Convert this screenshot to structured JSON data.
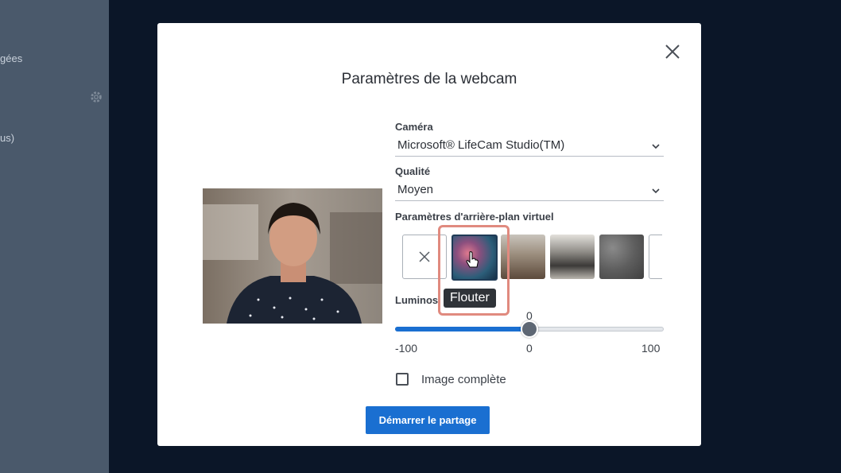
{
  "background": {
    "sidebar_fragments": [
      "gées",
      "us)"
    ]
  },
  "modal": {
    "title": "Paramètres de la webcam",
    "camera": {
      "label": "Caméra",
      "value": "Microsoft® LifeCam Studio(TM)"
    },
    "quality": {
      "label": "Qualité",
      "value": "Moyen"
    },
    "background_settings": {
      "label": "Paramètres d'arrière-plan virtuel",
      "options": [
        {
          "name": "none",
          "icon": "close-icon"
        },
        {
          "name": "blur"
        },
        {
          "name": "office-1"
        },
        {
          "name": "office-2"
        },
        {
          "name": "texture"
        },
        {
          "name": "more"
        }
      ],
      "tooltip": "Flouter"
    },
    "brightness": {
      "label": "Luminos",
      "value": 0,
      "value_label": "0",
      "min": -100,
      "max": 100,
      "min_label": "-100",
      "mid_label": "0",
      "max_label": "100"
    },
    "full_image": {
      "label": "Image complète",
      "checked": false
    },
    "start_button": "Démarrer le partage"
  },
  "colors": {
    "primary": "#1a6fd1",
    "highlight": "#e08a7f",
    "overlay": "#0c1a2e"
  }
}
